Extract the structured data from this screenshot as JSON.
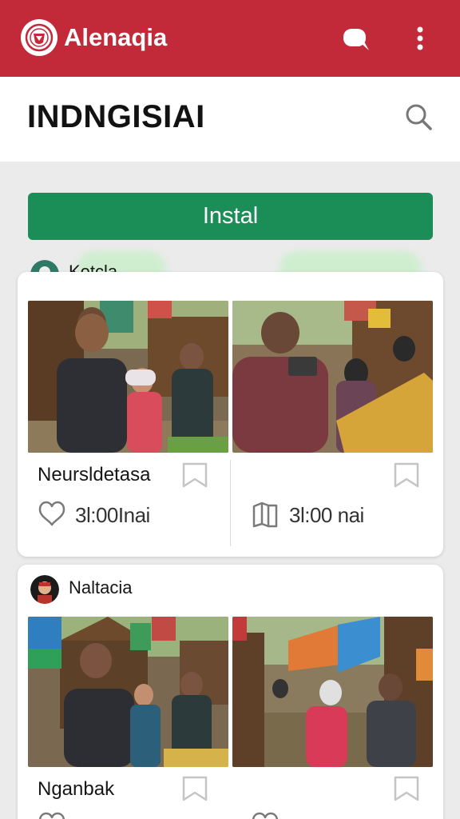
{
  "app": {
    "name": "Alenaqia"
  },
  "header": {
    "title": "INDNGISIAI"
  },
  "install": {
    "label": "Instal"
  },
  "posts": [
    {
      "author": "Ketcla",
      "items": [
        {
          "title": "Neursldetasa",
          "stat": "3l:00Inai",
          "stat_icon": "heart-icon"
        },
        {
          "title": "",
          "stat": "3l:00 nai",
          "stat_icon": "book-icon"
        }
      ]
    },
    {
      "author": "Naltacia",
      "items": [
        {
          "title": "Nganbak",
          "stat": "",
          "stat_icon": "heart-icon"
        },
        {
          "title": "",
          "stat": "",
          "stat_icon": "heart-icon"
        }
      ]
    }
  ],
  "colors": {
    "brand": "#c22a3a",
    "accent": "#1b8e57",
    "background": "#ebebeb"
  }
}
